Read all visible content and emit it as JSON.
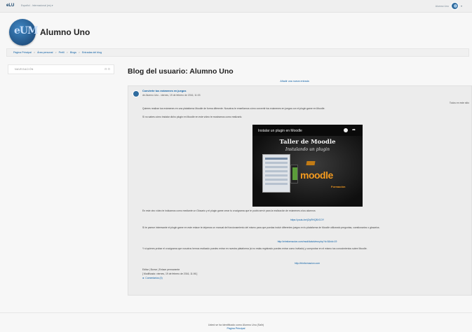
{
  "topbar": {
    "brand": "eLU",
    "language": "Español - Internacional (es) ▾",
    "user_name": "Alumno Uno",
    "caret": "▾"
  },
  "header": {
    "avatar_initials": "eUM",
    "title": "Alumno Uno"
  },
  "breadcrumb": [
    "Página Principal",
    "Área personal",
    "Perfil",
    "Blogs",
    "Entradas del blog"
  ],
  "breadcrumb_separator": ">",
  "navigation_block": {
    "title": "NAVEGACIÓN",
    "controls": "⊟ ⊡"
  },
  "blog": {
    "heading": "Blog del usuario: Alumno Uno",
    "add_entry": "Añadir una nueva entrada"
  },
  "entry": {
    "title": "Convierte tus exámenes en juegos",
    "meta": "de Alumno Uno - viernes, 19 de febrero de 2016, 11:03",
    "association": "Todos en este sitio",
    "paragraphs": [
      "Quieres realizar tus exámenes en una plataforma Moodle de forma diferente. Nosotros te enseñamos cómo convertir tus exámenes en juegos con el plugin game en Moodle.",
      "Si no sabes cómo instalar dicho plugin en Moodle en este vídeo te mostramos como realizarlo.",
      "En este otro vídeo te indicamos como mediante un Glosario y el plugin game crear tu crucigrama que te podrá servir para la realización de exámenes a tus alumnos",
      "Si te parece interesante el plugin game en este enlace te dejamos un manual del funcionamiento del mismo para que puedas incluir diferentes juegos en tu plataforma de Moodle utilizando preguntas, cuestionarios o glosarios.",
      "Y si quieres probar el crucigrama que nosotros hemos realizado puedes entrar en nuestra plataforma (si no estás registrado puedes entrar como invitado) y comprobar en el mismo tus conocimientos sobre Moodle."
    ],
    "links": [
      "https://youtu.be/jOyRHQ8VCOY",
      "http://elmformacion.com/mod/data/view.php?d=5&rid=19",
      "http://elmformacion.com"
    ],
    "actions": "Editar | Borrar | Enlace permanente",
    "modified": "[ Modificado: viernes, 19 de febrero de 2016, 11:06 ]",
    "comments": "► Comentarios (0)"
  },
  "video": {
    "title": "Instalar un plugin en Moodle",
    "share_icon": "share-icon",
    "heading": "Taller de Moodle",
    "subheading": "Instalando un plugin",
    "logo": "moodle",
    "logo_sub": "Formación"
  },
  "footer": {
    "login_info": "Usted se ha identificado como Alumno Uno (Salir)",
    "home": "Página Principal"
  }
}
